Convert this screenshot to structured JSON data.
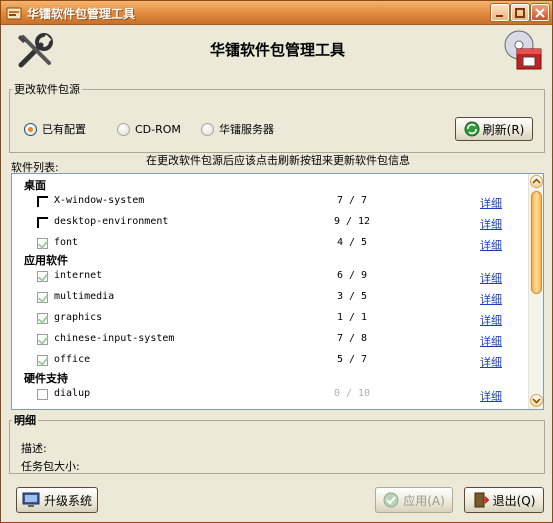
{
  "window": {
    "title": "华镭软件包管理工具",
    "header_title": "华镭软件包管理工具"
  },
  "source": {
    "group_label": "更改软件包源",
    "options": [
      {
        "label": "已有配置",
        "selected": true,
        "enabled": true
      },
      {
        "label": "CD-ROM",
        "selected": false,
        "enabled": false
      },
      {
        "label": "华镭服务器",
        "selected": false,
        "enabled": false
      }
    ],
    "refresh_label": "刷新(R)",
    "note": "在更改软件包源后应该点击刷新按钮来更新软件包信息"
  },
  "packages": {
    "list_label": "软件列表:",
    "detail_link_label": "详细",
    "categories": [
      {
        "name": "桌面",
        "items": [
          {
            "name": "X-window-system",
            "count": "7 / 7",
            "state": "partial"
          },
          {
            "name": "desktop-environment",
            "count": "9 / 12",
            "state": "partial"
          },
          {
            "name": "font",
            "count": "4 / 5",
            "state": "checked"
          }
        ]
      },
      {
        "name": "应用软件",
        "items": [
          {
            "name": "internet",
            "count": "6 / 9",
            "state": "checked"
          },
          {
            "name": "multimedia",
            "count": "3 / 5",
            "state": "checked"
          },
          {
            "name": "graphics",
            "count": "1 / 1",
            "state": "checked"
          },
          {
            "name": "chinese-input-system",
            "count": "7 / 8",
            "state": "checked"
          },
          {
            "name": "office",
            "count": "5 / 7",
            "state": "checked"
          }
        ]
      },
      {
        "name": "硬件支持",
        "items": [
          {
            "name": "dialup",
            "count": "0 / 10",
            "state": "unchecked"
          }
        ]
      }
    ]
  },
  "detail": {
    "label": "明细",
    "description_label": "描述:",
    "size_label": "任务包大小:"
  },
  "buttons": {
    "upgrade": "升级系统",
    "apply": "应用(A)",
    "exit": "退出(Q)"
  },
  "colors": {
    "titlebar": "#e0893d",
    "link": "#1a3fbf",
    "background": "#ece9d8"
  }
}
